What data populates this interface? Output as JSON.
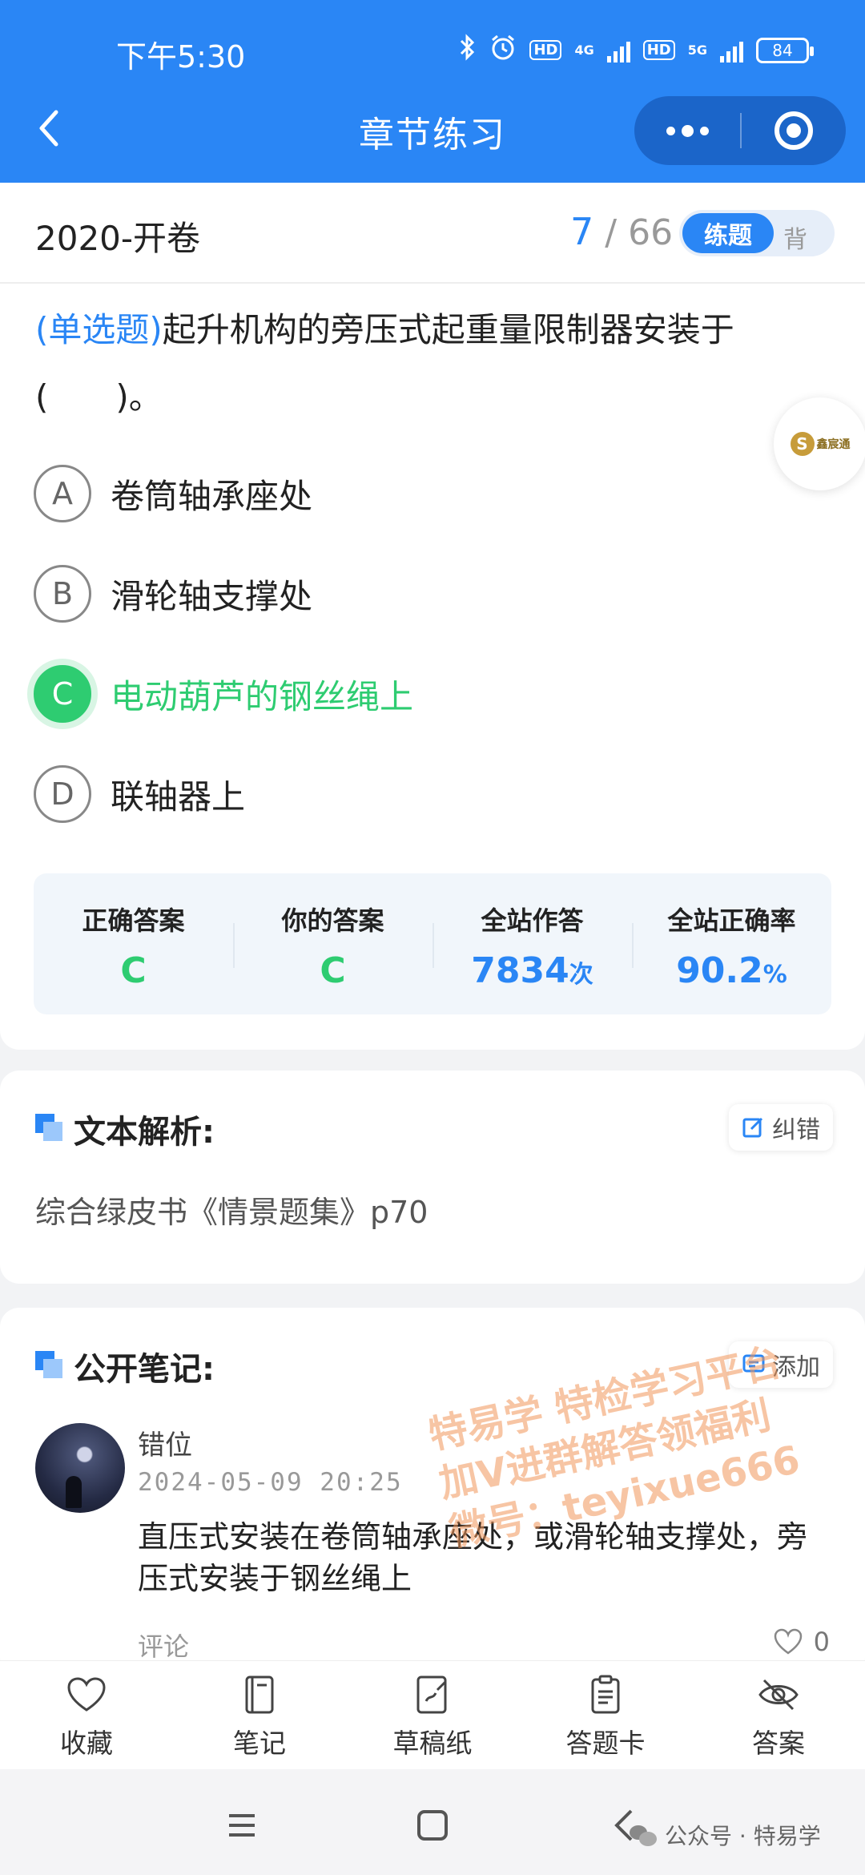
{
  "status": {
    "time": "下午5:30",
    "net1": "4G",
    "net2": "5G",
    "hd": "HD",
    "battery": "84"
  },
  "titlebar": {
    "title": "章节练习"
  },
  "header": {
    "chapter": "2020-开卷",
    "current": "7",
    "sep": "/",
    "total": "66",
    "mode_active": "练题",
    "mode_inactive": "背"
  },
  "question": {
    "type": "(单选题)",
    "text": "起升机构的旁压式起重量限制器安装于(　　)。",
    "options": [
      {
        "letter": "A",
        "text": "卷筒轴承座处"
      },
      {
        "letter": "B",
        "text": "滑轮轴支撑处"
      },
      {
        "letter": "C",
        "text": "电动葫芦的钢丝绳上"
      },
      {
        "letter": "D",
        "text": "联轴器上"
      }
    ],
    "correct_letter": "C"
  },
  "float_badge": {
    "text": "鑫宸通"
  },
  "stats": {
    "correct_label": "正确答案",
    "correct_value": "C",
    "yours_label": "你的答案",
    "yours_value": "C",
    "attempts_label": "全站作答",
    "attempts_value": "7834",
    "attempts_unit": "次",
    "rate_label": "全站正确率",
    "rate_value": "90.2",
    "rate_unit": "%"
  },
  "explanation": {
    "title": "文本解析:",
    "correct_btn": "纠错",
    "text": "综合绿皮书《情景题集》p70"
  },
  "notes": {
    "title": "公开笔记:",
    "add_btn": "添加",
    "items": [
      {
        "user": "错位",
        "time": "2024-05-09 20:25",
        "body": "直压式安装在卷筒轴承座处，或滑轮轴支撑处，旁压式安装于钢丝绳上",
        "comment": "评论",
        "likes": "0"
      }
    ]
  },
  "watermark": {
    "line1": "特易学 特检学习平台",
    "line2": "加V进群解答领福利",
    "line3": "微号：teyixue666"
  },
  "toolbar": {
    "items": [
      {
        "label": "收藏",
        "icon": "heart-icon"
      },
      {
        "label": "笔记",
        "icon": "notebook-icon"
      },
      {
        "label": "草稿纸",
        "icon": "draft-icon"
      },
      {
        "label": "答题卡",
        "icon": "answer-card-icon"
      },
      {
        "label": "答案",
        "icon": "eye-off-icon"
      }
    ]
  },
  "footer_tag": "公众号 · 特易学",
  "colors": {
    "primary": "#2a86f5",
    "correct": "#2ecc71"
  }
}
